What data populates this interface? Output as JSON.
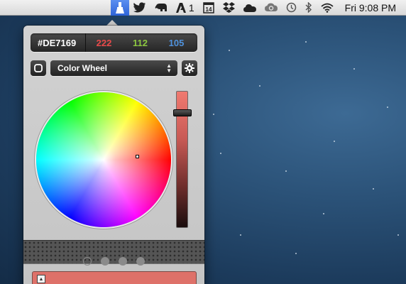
{
  "menubar": {
    "items": [
      {
        "name": "color-picker-icon",
        "active": true
      },
      {
        "name": "twitter-bird-icon"
      },
      {
        "name": "evernote-elephant-icon"
      },
      {
        "name": "adobe-icon",
        "badge": "1"
      },
      {
        "name": "calendar-icon",
        "day": "14"
      },
      {
        "name": "dropbox-icon"
      },
      {
        "name": "cloud-icon"
      },
      {
        "name": "creative-cloud-icon"
      },
      {
        "name": "time-machine-icon"
      },
      {
        "name": "bluetooth-icon"
      },
      {
        "name": "wifi-icon"
      }
    ],
    "clock": "Fri 9:08 PM"
  },
  "picker": {
    "hex": "#DE7169",
    "r": "222",
    "g": "112",
    "b": "105",
    "colors": {
      "r": "#e84a4a",
      "g": "#8cc640",
      "b": "#4f92dd",
      "current": "#de7169"
    },
    "mode": "Color Wheel",
    "brightness_level": 0.86,
    "pages": 4,
    "current_page": 0
  }
}
